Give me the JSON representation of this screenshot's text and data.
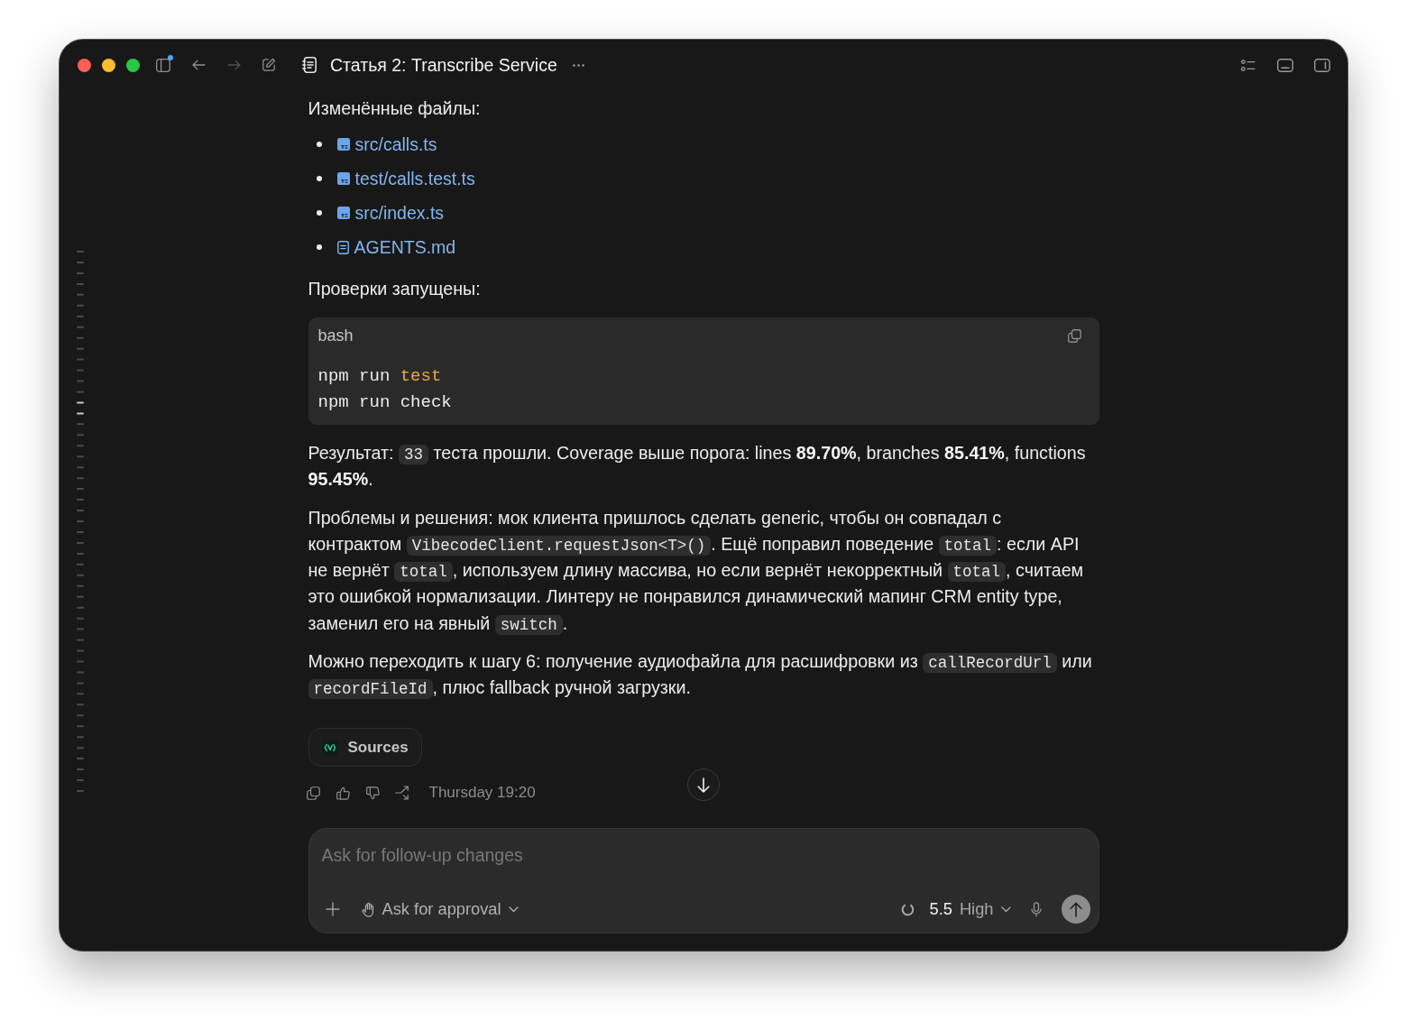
{
  "window": {
    "title": "Статья 2: Transcribe Service"
  },
  "toolbar": [
    {
      "kind": "sidebar",
      "badge": true,
      "disabled": false
    },
    {
      "kind": "back",
      "badge": false,
      "disabled": false
    },
    {
      "kind": "forward",
      "badge": false,
      "disabled": true
    },
    {
      "kind": "compose",
      "badge": false,
      "disabled": false
    }
  ],
  "toolbar_right": [
    {
      "kind": "list"
    },
    {
      "kind": "panel_bottom"
    },
    {
      "kind": "panel_right"
    }
  ],
  "message": {
    "blocks": [
      {
        "kind": "paragraph",
        "segments": [
          {
            "kind": "text",
            "text": "Изменённые файлы:"
          }
        ]
      },
      {
        "kind": "file_list",
        "items": [
          {
            "kind": "ts",
            "name": "src/calls.ts"
          },
          {
            "kind": "ts",
            "name": "test/calls.test.ts"
          },
          {
            "kind": "ts",
            "name": "src/index.ts"
          },
          {
            "kind": "md",
            "name": "AGENTS.md"
          }
        ]
      },
      {
        "kind": "paragraph",
        "segments": [
          {
            "kind": "text",
            "text": "Проверки запущены:"
          }
        ]
      },
      {
        "kind": "code",
        "language": "bash",
        "lines": [
          {
            "tokens": [
              {
                "kind": "plain",
                "text": "npm run "
              },
              {
                "kind": "keyword",
                "text": "test"
              }
            ]
          },
          {
            "tokens": [
              {
                "kind": "plain",
                "text": "npm run check"
              }
            ]
          }
        ]
      },
      {
        "kind": "paragraph",
        "segments": [
          {
            "kind": "text",
            "text": "Результат: "
          },
          {
            "kind": "code",
            "text": "33"
          },
          {
            "kind": "text",
            "text": " теста прошли. Coverage выше порога: lines **89.70%**, branches **85.41%**, functions **95.45%**."
          }
        ]
      },
      {
        "kind": "paragraph",
        "segments": [
          {
            "kind": "text",
            "text": "Проблемы и решения: мок клиента пришлось сделать generic, чтобы он совпадал с контрактом "
          },
          {
            "kind": "code",
            "text": "VibecodeClient.requestJson<T>()"
          },
          {
            "kind": "text",
            "text": ". Ещё поправил поведение "
          },
          {
            "kind": "code",
            "text": "total"
          },
          {
            "kind": "text",
            "text": ": если API не вернёт "
          },
          {
            "kind": "code",
            "text": "total"
          },
          {
            "kind": "text",
            "text": ", используем длину массива, но если вернёт некорректный "
          },
          {
            "kind": "code",
            "text": "total"
          },
          {
            "kind": "text",
            "text": ", считаем это ошибкой нормализации. Линтеру не понравился динамический мапинг CRM entity type, заменил его на явный "
          },
          {
            "kind": "code",
            "text": "switch"
          },
          {
            "kind": "text",
            "text": "."
          }
        ]
      },
      {
        "kind": "paragraph",
        "segments": [
          {
            "kind": "text",
            "text": "Можно переходить к шагу 6: получение аудиофайла для расшифровки из "
          },
          {
            "kind": "code",
            "text": "callRecordUrl"
          },
          {
            "kind": "text",
            "text": " или "
          },
          {
            "kind": "code",
            "text": "recordFileId"
          },
          {
            "kind": "text",
            "text": ", плюс fallback ручной загрузки."
          }
        ]
      }
    ],
    "sources": {
      "label": "Sources"
    },
    "timestamp": "Thursday 19:20"
  },
  "composer": {
    "placeholder": "Ask for follow-up changes",
    "approval": "Ask for approval",
    "model": {
      "version": "5.5",
      "effort": "High"
    }
  }
}
